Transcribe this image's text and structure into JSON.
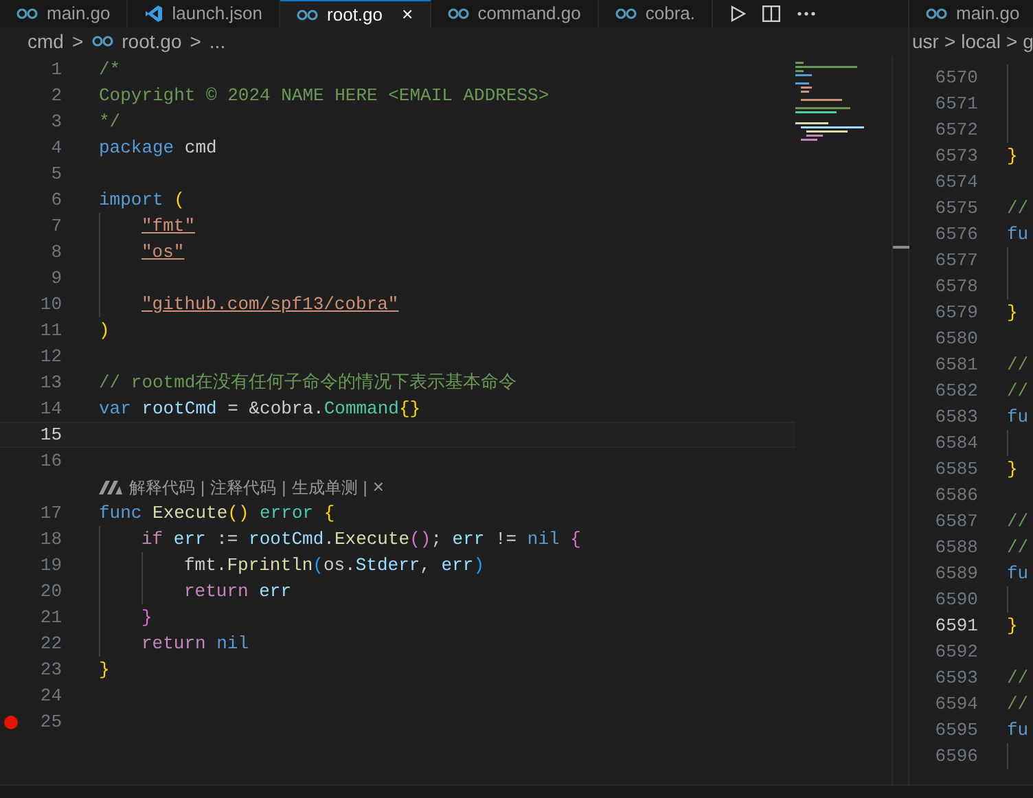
{
  "tabs": [
    {
      "label": "main.go",
      "kind": "go",
      "selected": false
    },
    {
      "label": "launch.json",
      "kind": "json",
      "selected": false
    },
    {
      "label": "root.go",
      "kind": "go",
      "selected": true,
      "close": "×"
    },
    {
      "label": "command.go",
      "kind": "go",
      "selected": false
    },
    {
      "label": "cobra.",
      "kind": "go",
      "selected": false
    }
  ],
  "right_tabs": [
    {
      "label": "main.go",
      "kind": "go",
      "selected": false
    }
  ],
  "breadcrumbs": [
    {
      "label": "cmd",
      "kind": "folder"
    },
    {
      "label": "root.go",
      "kind": "go"
    },
    {
      "label": "...",
      "kind": "symbol"
    }
  ],
  "right_breadcrumbs": [
    {
      "label": "usr"
    },
    {
      "label": "local"
    },
    {
      "label": "g"
    }
  ],
  "breadcrumb_separator": ">",
  "lines": [
    {
      "kind": "code",
      "number": "1",
      "tokens": [
        {
          "t": "/*",
          "kind": "comment"
        }
      ]
    },
    {
      "kind": "code",
      "number": "2",
      "tokens": [
        {
          "t": "Copyright © 2024 NAME HERE <EMAIL ADDRESS>",
          "kind": "comment"
        }
      ]
    },
    {
      "kind": "code",
      "number": "3",
      "tokens": [
        {
          "t": "*/",
          "kind": "comment"
        }
      ]
    },
    {
      "kind": "code",
      "number": "4",
      "tokens": [
        {
          "t": "package",
          "kind": "keyword"
        },
        {
          "t": " cmd",
          "kind": "plain"
        }
      ]
    },
    {
      "kind": "code",
      "number": "5"
    },
    {
      "kind": "code",
      "number": "6",
      "tokens": [
        {
          "t": "import",
          "kind": "keyword"
        },
        {
          "t": " (",
          "kind": "bracket1"
        }
      ],
      "children": [
        {
          "kind": "code",
          "number": "7",
          "tokens": [
            {
              "t": "\"fmt\"",
              "kind": "string"
            }
          ]
        },
        {
          "kind": "code",
          "number": "8",
          "tokens": [
            {
              "t": "\"os\"",
              "kind": "string"
            }
          ]
        },
        {
          "kind": "code",
          "number": "9"
        },
        {
          "kind": "code",
          "number": "10",
          "tokens": [
            {
              "t": "\"github.com/spf13/cobra\"",
              "kind": "string"
            }
          ]
        }
      ]
    },
    {
      "kind": "code",
      "number": "11",
      "tokens": [
        {
          "t": ")",
          "kind": "bracket1"
        }
      ]
    },
    {
      "kind": "code",
      "number": "12"
    },
    {
      "kind": "code",
      "number": "13",
      "tokens": [
        {
          "t": "// rootmd在没有任何子命令的情况下表示基本命令",
          "kind": "comment"
        }
      ]
    },
    {
      "kind": "code",
      "number": "14",
      "tokens": [
        {
          "t": "var",
          "kind": "keyword"
        },
        {
          "t": " rootCmd",
          "kind": "variable"
        },
        {
          "t": " = &cobra.",
          "kind": "plain"
        },
        {
          "t": "Command",
          "kind": "type"
        },
        {
          "t": "{}",
          "kind": "bracket1"
        }
      ]
    },
    {
      "kind": "code",
      "number": "15",
      "current": true
    },
    {
      "kind": "code",
      "number": "16"
    },
    {
      "kind": "codelens",
      "actions": [
        "解释代码",
        "注释代码",
        "生成单测"
      ],
      "separator": "|",
      "close": "×"
    },
    {
      "kind": "code",
      "number": "17",
      "tokens": [
        {
          "t": "func",
          "kind": "keyword"
        },
        {
          "t": " Execute",
          "kind": "function"
        },
        {
          "t": "()",
          "kind": "bracket1"
        },
        {
          "t": " error",
          "kind": "type"
        },
        {
          "t": " {",
          "kind": "bracket1"
        }
      ],
      "children": [
        {
          "kind": "code",
          "number": "18",
          "tokens": [
            {
              "t": "if",
              "kind": "control"
            },
            {
              "t": " err",
              "kind": "variable"
            },
            {
              "t": " := ",
              "kind": "plain"
            },
            {
              "t": "rootCmd",
              "kind": "variable"
            },
            {
              "t": ".",
              "kind": "plain"
            },
            {
              "t": "Execute",
              "kind": "function"
            },
            {
              "t": "()",
              "kind": "bracket2"
            },
            {
              "t": "; ",
              "kind": "plain"
            },
            {
              "t": "err",
              "kind": "variable"
            },
            {
              "t": " != ",
              "kind": "plain"
            },
            {
              "t": "nil",
              "kind": "keyword"
            },
            {
              "t": " {",
              "kind": "bracket2"
            }
          ],
          "children": [
            {
              "kind": "code",
              "number": "19",
              "tokens": [
                {
                  "t": "fmt.",
                  "kind": "plain"
                },
                {
                  "t": "Fprintln",
                  "kind": "function"
                },
                {
                  "t": "(",
                  "kind": "bracket3"
                },
                {
                  "t": "os.",
                  "kind": "plain"
                },
                {
                  "t": "Stderr",
                  "kind": "variable"
                },
                {
                  "t": ", ",
                  "kind": "plain"
                },
                {
                  "t": "err",
                  "kind": "variable"
                },
                {
                  "t": ")",
                  "kind": "bracket3"
                }
              ]
            },
            {
              "kind": "code",
              "number": "20",
              "tokens": [
                {
                  "t": "return",
                  "kind": "control"
                },
                {
                  "t": " err",
                  "kind": "variable"
                }
              ]
            }
          ]
        },
        {
          "kind": "code",
          "number": "21",
          "tokens": [
            {
              "t": "}",
              "kind": "bracket2"
            }
          ]
        },
        {
          "kind": "code",
          "number": "22",
          "tokens": [
            {
              "t": "return",
              "kind": "control"
            },
            {
              "t": " nil",
              "kind": "keyword"
            }
          ]
        }
      ]
    },
    {
      "kind": "code",
      "number": "23",
      "tokens": [
        {
          "t": "}",
          "kind": "bracket1"
        }
      ]
    },
    {
      "kind": "code",
      "number": "24"
    },
    {
      "kind": "code",
      "number": "25",
      "breakpoint": true
    }
  ],
  "right_lines": [
    {
      "kind": "block",
      "children": [
        {
          "kind": "code",
          "number": "6570"
        },
        {
          "kind": "code",
          "number": "6571"
        },
        {
          "kind": "code",
          "number": "6572"
        }
      ]
    },
    {
      "kind": "code",
      "number": "6573",
      "tokens": [
        {
          "t": "}",
          "kind": "bracket1"
        }
      ]
    },
    {
      "kind": "code",
      "number": "6574"
    },
    {
      "kind": "code",
      "number": "6575",
      "tokens": [
        {
          "t": "//",
          "kind": "comment"
        }
      ]
    },
    {
      "kind": "code",
      "number": "6576",
      "tokens": [
        {
          "t": "fu",
          "kind": "keyword"
        }
      ],
      "children": [
        {
          "kind": "code",
          "number": "6577"
        },
        {
          "kind": "code",
          "number": "6578"
        }
      ]
    },
    {
      "kind": "code",
      "number": "6579",
      "tokens": [
        {
          "t": "}",
          "kind": "bracket1"
        }
      ]
    },
    {
      "kind": "code",
      "number": "6580"
    },
    {
      "kind": "code",
      "number": "6581",
      "tokens": [
        {
          "t": "//",
          "kind": "comment"
        }
      ]
    },
    {
      "kind": "code",
      "number": "6582",
      "tokens": [
        {
          "t": "//",
          "kind": "comment"
        }
      ]
    },
    {
      "kind": "code",
      "number": "6583",
      "tokens": [
        {
          "t": "fu",
          "kind": "keyword"
        }
      ],
      "children": [
        {
          "kind": "code",
          "number": "6584"
        }
      ]
    },
    {
      "kind": "code",
      "number": "6585",
      "tokens": [
        {
          "t": "}",
          "kind": "bracket1"
        }
      ]
    },
    {
      "kind": "code",
      "number": "6586"
    },
    {
      "kind": "code",
      "number": "6587",
      "tokens": [
        {
          "t": "//",
          "kind": "comment"
        }
      ]
    },
    {
      "kind": "code",
      "number": "6588",
      "tokens": [
        {
          "t": "//",
          "kind": "comment"
        }
      ]
    },
    {
      "kind": "code",
      "number": "6589",
      "tokens": [
        {
          "t": "fu",
          "kind": "keyword"
        }
      ],
      "children": [
        {
          "kind": "code",
          "number": "6590"
        }
      ]
    },
    {
      "kind": "code",
      "number": "6591",
      "current": true,
      "tokens": [
        {
          "t": "}",
          "kind": "bracket1"
        }
      ]
    },
    {
      "kind": "code",
      "number": "6592"
    },
    {
      "kind": "code",
      "number": "6593",
      "tokens": [
        {
          "t": "//",
          "kind": "comment"
        }
      ]
    },
    {
      "kind": "code",
      "number": "6594",
      "tokens": [
        {
          "t": "//",
          "kind": "comment"
        }
      ]
    },
    {
      "kind": "code",
      "number": "6595",
      "tokens": [
        {
          "t": "fu",
          "kind": "keyword"
        }
      ],
      "children": [
        {
          "kind": "code",
          "number": "6596"
        }
      ]
    }
  ]
}
